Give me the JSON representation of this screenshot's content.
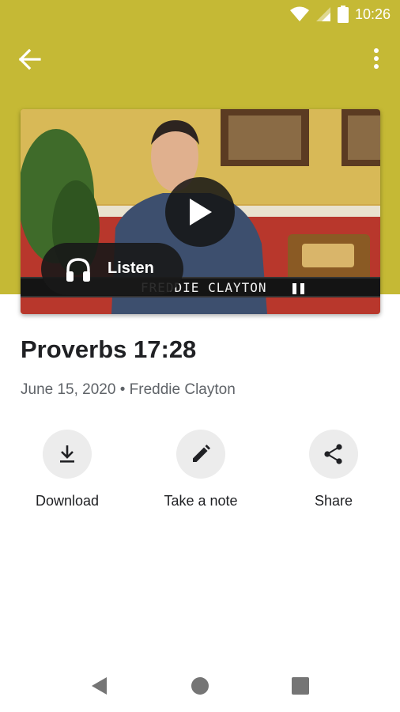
{
  "status_bar": {
    "time": "10:26",
    "icons": [
      "wifi-icon",
      "cell-signal-icon",
      "battery-icon"
    ]
  },
  "app_bar": {
    "back_icon": "arrow-back-icon",
    "menu_icon": "more-vert-icon"
  },
  "video": {
    "play_icon": "play-icon",
    "listen_label": "Listen",
    "listen_icon": "headphones-icon",
    "overlay_name": "FREDDIE CLAYTON"
  },
  "sermon": {
    "title": "Proverbs 17:28",
    "meta": "June 15, 2020 • Freddie Clayton"
  },
  "actions": [
    {
      "label": "Download",
      "icon": "download-icon"
    },
    {
      "label": "Take a note",
      "icon": "pencil-icon"
    },
    {
      "label": "Share",
      "icon": "share-icon"
    }
  ],
  "nav_bar": {
    "buttons": [
      "back-triangle-icon",
      "home-circle-icon",
      "recents-square-icon"
    ]
  },
  "colors": {
    "header": "#c5b935",
    "action_circle": "#ececec",
    "text_primary": "#202124",
    "text_secondary": "#5f6368"
  }
}
